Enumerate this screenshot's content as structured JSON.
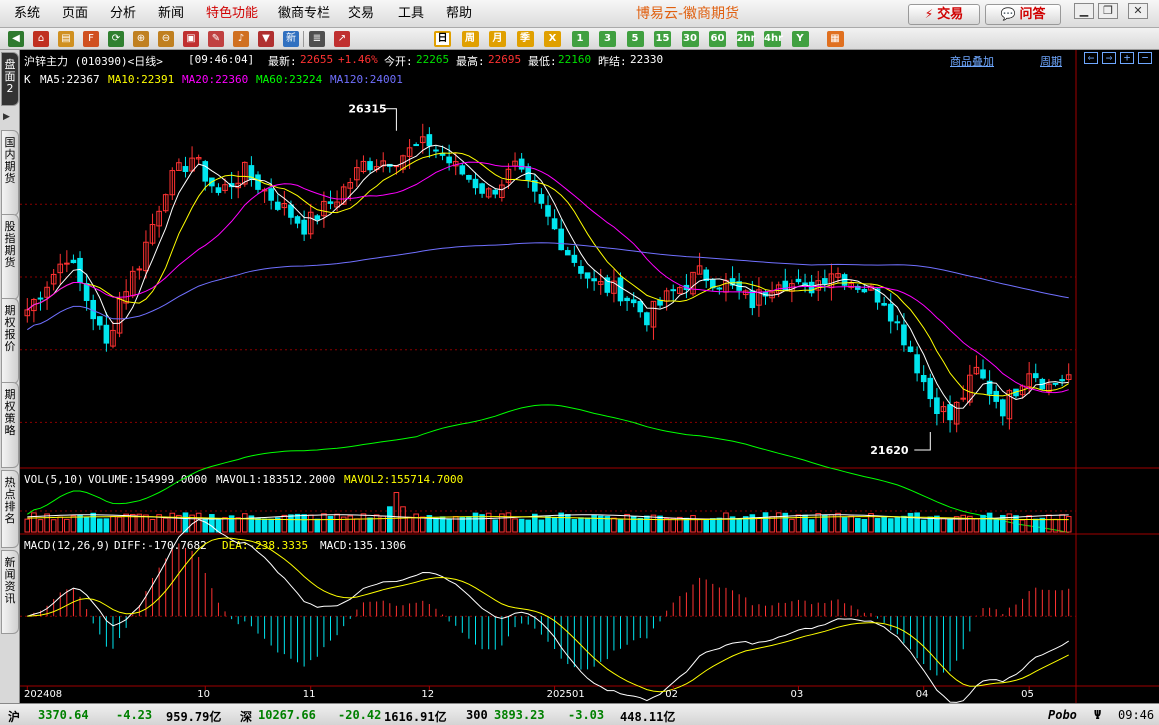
{
  "menu": [
    "系统",
    "页面",
    "分析",
    "新闻",
    "特色功能",
    "徽商专栏",
    "交易",
    "工具",
    "帮助"
  ],
  "app_title": "博易云-徽商期货",
  "buttons": {
    "trade": "交易",
    "ask": "问答"
  },
  "window_buttons": {
    "minimize": "▁",
    "restore": "❐",
    "close": "✕"
  },
  "toolbar_icons": [
    {
      "name": "back-icon",
      "glyph": "◀",
      "color": "#2f7a2f"
    },
    {
      "name": "home-icon",
      "glyph": "⌂",
      "color": "#c03020"
    },
    {
      "name": "folder-icon",
      "glyph": "▤",
      "color": "#d09020"
    },
    {
      "name": "f10-icon",
      "glyph": "F",
      "color": "#d05020"
    },
    {
      "name": "refresh-icon",
      "glyph": "⟳",
      "color": "#308030"
    },
    {
      "name": "zoom-in-icon",
      "glyph": "⊕",
      "color": "#c08020"
    },
    {
      "name": "zoom-out-icon",
      "glyph": "⊖",
      "color": "#c08020"
    },
    {
      "name": "window-icon",
      "glyph": "▣",
      "color": "#c03030"
    },
    {
      "name": "pen-icon",
      "glyph": "✎",
      "color": "#c04040"
    },
    {
      "name": "bell-icon",
      "glyph": "♪",
      "color": "#d07020"
    },
    {
      "name": "filter-icon",
      "glyph": "▼",
      "color": "#b03030"
    },
    {
      "name": "new-icon",
      "glyph": "新",
      "color": "#3070c0"
    },
    {
      "name": "list-icon",
      "glyph": "≣",
      "color": "#505050"
    },
    {
      "name": "trend-icon",
      "glyph": "↗",
      "color": "#c03030"
    }
  ],
  "periods": [
    {
      "label": "日",
      "color": "#e0a000",
      "active": true
    },
    {
      "label": "周",
      "color": "#e0a000"
    },
    {
      "label": "月",
      "color": "#e0a000"
    },
    {
      "label": "季",
      "color": "#e0a000"
    },
    {
      "label": "X",
      "color": "#e0a000"
    },
    {
      "label": "1",
      "color": "#40a040"
    },
    {
      "label": "3",
      "color": "#40a040"
    },
    {
      "label": "5",
      "color": "#40a040"
    },
    {
      "label": "15",
      "color": "#40a040"
    },
    {
      "label": "30",
      "color": "#40a040"
    },
    {
      "label": "60",
      "color": "#40a040"
    },
    {
      "label": "2hr",
      "color": "#40a040"
    },
    {
      "label": "4hr",
      "color": "#40a040"
    },
    {
      "label": "Y",
      "color": "#40a040"
    },
    {
      "label": "▦",
      "color": "#e07020"
    }
  ],
  "left_tabs": [
    {
      "label": "盘面2",
      "active": true
    },
    {
      "label": "国内期货"
    },
    {
      "label": "股指期货"
    },
    {
      "label": "期权报价"
    },
    {
      "label": "期权策略"
    },
    {
      "label": "热点排名"
    },
    {
      "label": "新闻资讯"
    }
  ],
  "quote": {
    "name": "沪锌主力 (010390)<日线>",
    "time": "[09:46:04]",
    "latest_label": "最新:",
    "latest": "22655",
    "change": "+1.46%",
    "open_label": "今开:",
    "open": "22265",
    "high_label": "最高:",
    "high": "22695",
    "low_label": "最低:",
    "low": "22160",
    "prev_label": "昨结:",
    "prev": "22330"
  },
  "links": {
    "overlay": "商品叠加",
    "period": "周期"
  },
  "ma": {
    "k": "K",
    "ma5": "MA5:22367",
    "ma10": "MA10:22391",
    "ma20": "MA20:22360",
    "ma60": "MA60:23224",
    "ma120": "MA120:24001"
  },
  "annotations": {
    "high": "26315",
    "low": "21620"
  },
  "vol_header": {
    "title": "VOL(5,10)",
    "volume": "VOLUME:154999.0000",
    "mavol1": "MAVOL1:183512.2000",
    "mavol2": "MAVOL2:155714.7000"
  },
  "macd_header": {
    "title": "MACD(12,26,9)",
    "diff": "DIFF:-170.7682",
    "dea": "DEA:-238.3335",
    "macd": "MACD:135.1306"
  },
  "colors": {
    "up": "#ff3232",
    "down": "#00e5ee",
    "ma5": "#ffffff",
    "ma10": "#ffff00",
    "ma20": "#ff00ff",
    "ma60": "#00ff00",
    "ma120": "#7070ff",
    "grid": "#8b0000"
  },
  "chart_data": {
    "type": "candlestick",
    "title": "沪锌主力 (010390)<日线>",
    "x_ticks": [
      "202408",
      "10",
      "11",
      "12",
      "202501",
      "02",
      "03",
      "04",
      "05"
    ],
    "ylim": [
      21400,
      26600
    ],
    "anchors": [
      [
        0,
        23550
      ],
      [
        6,
        24300
      ],
      [
        9,
        23700
      ],
      [
        12,
        23050
      ],
      [
        14,
        23700
      ],
      [
        17,
        24200
      ],
      [
        21,
        25250
      ],
      [
        25,
        25650
      ],
      [
        29,
        25150
      ],
      [
        33,
        25450
      ],
      [
        37,
        25100
      ],
      [
        42,
        24700
      ],
      [
        47,
        25100
      ],
      [
        51,
        25550
      ],
      [
        56,
        25650
      ],
      [
        61,
        25850
      ],
      [
        65,
        25500
      ],
      [
        70,
        25150
      ],
      [
        74,
        25500
      ],
      [
        78,
        24950
      ],
      [
        82,
        24350
      ],
      [
        86,
        23900
      ],
      [
        90,
        23800
      ],
      [
        94,
        23450
      ],
      [
        98,
        23800
      ],
      [
        102,
        24050
      ],
      [
        106,
        23900
      ],
      [
        110,
        23650
      ],
      [
        114,
        24000
      ],
      [
        118,
        23800
      ],
      [
        122,
        24100
      ],
      [
        126,
        23900
      ],
      [
        130,
        23700
      ],
      [
        134,
        23000
      ],
      [
        137,
        22350
      ],
      [
        140,
        22050
      ],
      [
        144,
        22700
      ],
      [
        148,
        22200
      ],
      [
        152,
        22750
      ],
      [
        155,
        22500
      ],
      [
        158,
        22655
      ]
    ],
    "volume": {
      "ylim": [
        0,
        500000
      ]
    },
    "macd": {
      "ylim": [
        -360,
        320
      ]
    },
    "series": [
      {
        "name": "MA5",
        "period": 5,
        "value": 22367
      },
      {
        "name": "MA10",
        "period": 10,
        "value": 22391
      },
      {
        "name": "MA20",
        "period": 20,
        "value": 22360
      },
      {
        "name": "MA60",
        "period": 60,
        "value": 23224
      },
      {
        "name": "MA120",
        "period": 120,
        "value": 24001
      }
    ]
  },
  "status": {
    "sh_label": "沪",
    "sh_index": "3370.64",
    "sh_change": "-4.23",
    "sh_amount": "959.79亿",
    "sz_label": "深",
    "sz_index": "10267.66",
    "sz_change": "-20.42",
    "sz_amount": "1616.91亿",
    "hs_label": "300",
    "hs_index": "3893.23",
    "hs_change": "-3.03",
    "hs_amount": "448.11亿",
    "brand": "Pobo",
    "clock": "09:46"
  }
}
